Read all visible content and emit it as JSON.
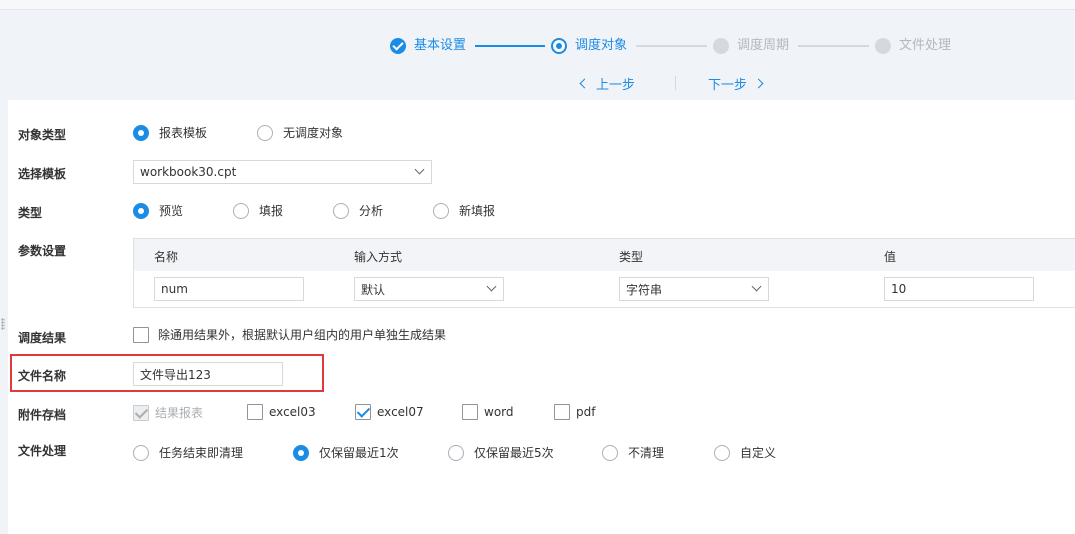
{
  "steps": [
    {
      "label": "基本设置",
      "state": "done"
    },
    {
      "label": "调度对象",
      "state": "current"
    },
    {
      "label": "调度周期",
      "state": "todo"
    },
    {
      "label": "文件处理",
      "state": "todo"
    }
  ],
  "nav": {
    "prev": "上一步",
    "next": "下一步"
  },
  "form": {
    "object_type": {
      "label": "对象类型",
      "options": [
        "报表模板",
        "无调度对象"
      ],
      "selected": "报表模板"
    },
    "template": {
      "label": "选择模板",
      "value": "workbook30.cpt"
    },
    "type": {
      "label": "类型",
      "options": [
        "预览",
        "填报",
        "分析",
        "新填报"
      ],
      "selected": "预览"
    },
    "params": {
      "label": "参数设置",
      "columns": [
        "名称",
        "输入方式",
        "类型",
        "值"
      ],
      "rows": [
        {
          "name": "num",
          "input_mode": "默认",
          "type": "字符串",
          "value": "10"
        }
      ]
    },
    "result": {
      "label": "调度结果",
      "checkbox_label": "除通用结果外，根据默认用户组内的用户单独生成结果",
      "checked": false
    },
    "filename": {
      "label": "文件名称",
      "value": "文件导出123"
    },
    "attachments": {
      "label": "附件存档",
      "options": [
        {
          "label": "结果报表",
          "checked": true,
          "disabled": true
        },
        {
          "label": "excel03",
          "checked": false,
          "disabled": false
        },
        {
          "label": "excel07",
          "checked": true,
          "disabled": false
        },
        {
          "label": "word",
          "checked": false,
          "disabled": false
        },
        {
          "label": "pdf",
          "checked": false,
          "disabled": false
        }
      ]
    },
    "file_processing": {
      "label": "文件处理",
      "options": [
        "任务结束即清理",
        "仅保留最近1次",
        "仅保留最近5次",
        "不清理",
        "自定义"
      ],
      "selected": "仅保留最近1次"
    }
  },
  "colors": {
    "accent": "#1a8ce6",
    "highlight": "#e03a3a",
    "inactive": "#b3b8bf"
  }
}
